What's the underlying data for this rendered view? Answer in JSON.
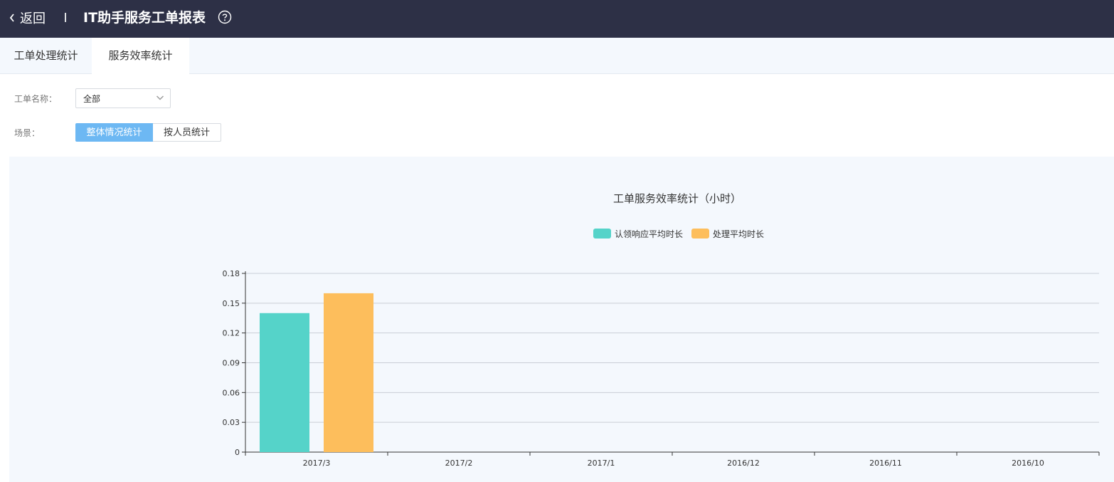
{
  "header": {
    "back_label": "返回",
    "title": "IT助手服务工单报表",
    "help_icon": "question-circle-icon",
    "bg_color": "#2d3046"
  },
  "tabs": [
    {
      "label": "工单处理统计",
      "active": false
    },
    {
      "label": "服务效率统计",
      "active": true
    }
  ],
  "filters": {
    "name_label": "工单名称：",
    "name_value": "全部",
    "scene_label": "场景：",
    "scene_options": [
      "整体情况统计",
      "按人员统计"
    ],
    "scene_selected": "整体情况统计"
  },
  "chart_data": {
    "type": "bar",
    "title": "工单服务效率统计（小时）",
    "categories": [
      "2017/3",
      "2017/2",
      "2017/1",
      "2016/12",
      "2016/11",
      "2016/10"
    ],
    "series": [
      {
        "name": "认领响应平均时长",
        "color": "#55d3c9",
        "values": [
          0.14,
          0,
          0,
          0,
          0,
          0
        ]
      },
      {
        "name": "处理平均时长",
        "color": "#fdbe5c",
        "values": [
          0.16,
          0,
          0,
          0,
          0,
          0
        ]
      }
    ],
    "ylim": [
      0,
      0.18
    ],
    "yticks": [
      "0",
      "0.03",
      "0.06",
      "0.09",
      "0.12",
      "0.15",
      "0.18"
    ],
    "grid": true,
    "legend": "top-center"
  }
}
